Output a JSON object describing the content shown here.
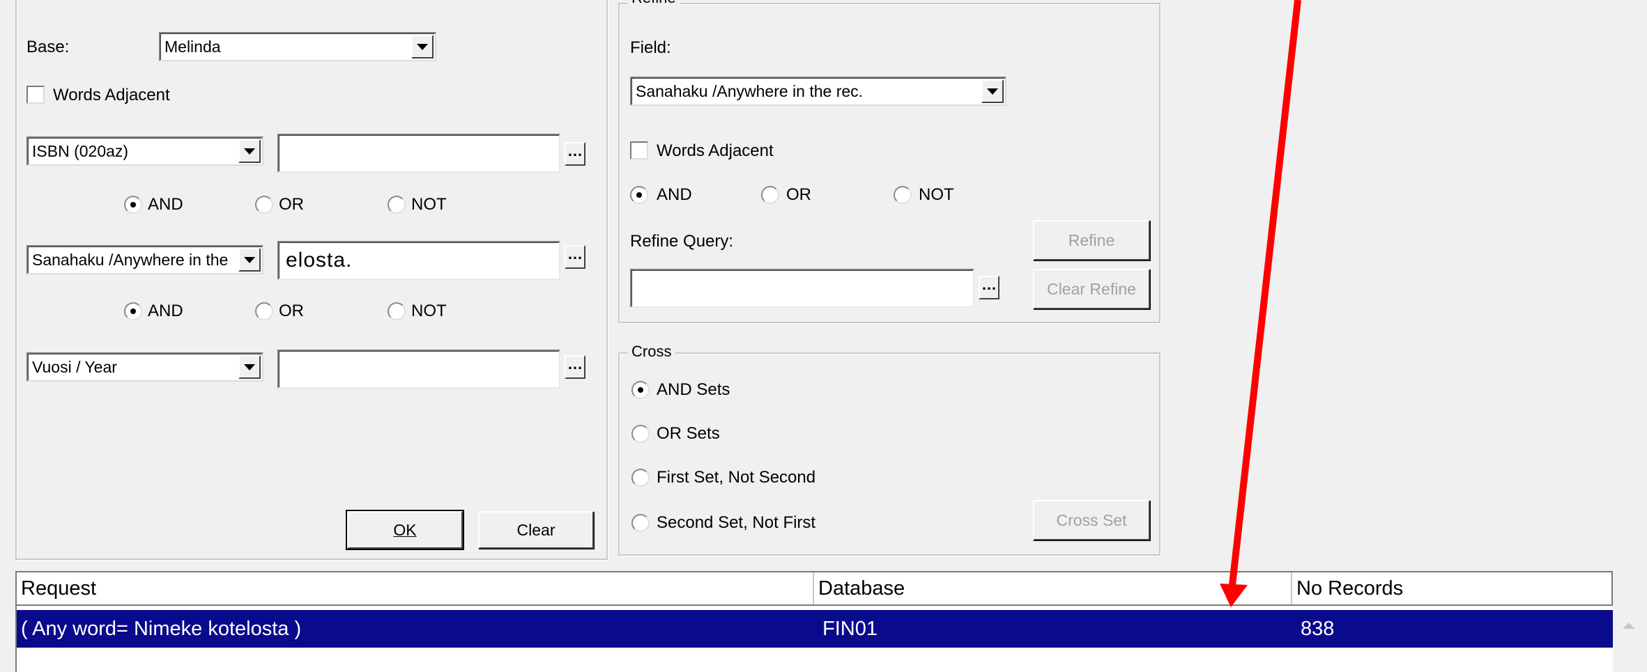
{
  "left_panel": {
    "base_label": "Base:",
    "base_value": "Melinda",
    "words_adjacent_label": "Words Adjacent",
    "rows": [
      {
        "field": "ISBN (020az)",
        "term": ""
      },
      {
        "field": "Sanahaku /Anywhere in the",
        "term": "elosta."
      },
      {
        "field": "Vuosi / Year",
        "term": ""
      }
    ],
    "ops": {
      "and": "AND",
      "or": "OR",
      "not": "NOT"
    },
    "ok_label": "OK",
    "clear_label": "Clear"
  },
  "refine": {
    "legend": "Refine",
    "field_label": "Field:",
    "field_value": "Sanahaku /Anywhere in the rec.",
    "words_adjacent_label": "Words Adjacent",
    "ops": {
      "and": "AND",
      "or": "OR",
      "not": "NOT"
    },
    "query_label": "Refine Query:",
    "query_value": "",
    "refine_button": "Refine",
    "clear_refine_button": "Clear Refine"
  },
  "cross": {
    "legend": "Cross",
    "options": [
      "AND Sets",
      "OR Sets",
      "First Set, Not Second",
      "Second Set, Not First"
    ],
    "cross_set_button": "Cross Set"
  },
  "results": {
    "columns": [
      "Request",
      "Database",
      "No Records"
    ],
    "rows": [
      {
        "request": "( Any word= Nimeke kotelosta )",
        "database": "FIN01",
        "records": "838"
      }
    ]
  },
  "colors": {
    "selection": "#0a0a8c",
    "annotation_arrow": "#ff0000"
  }
}
